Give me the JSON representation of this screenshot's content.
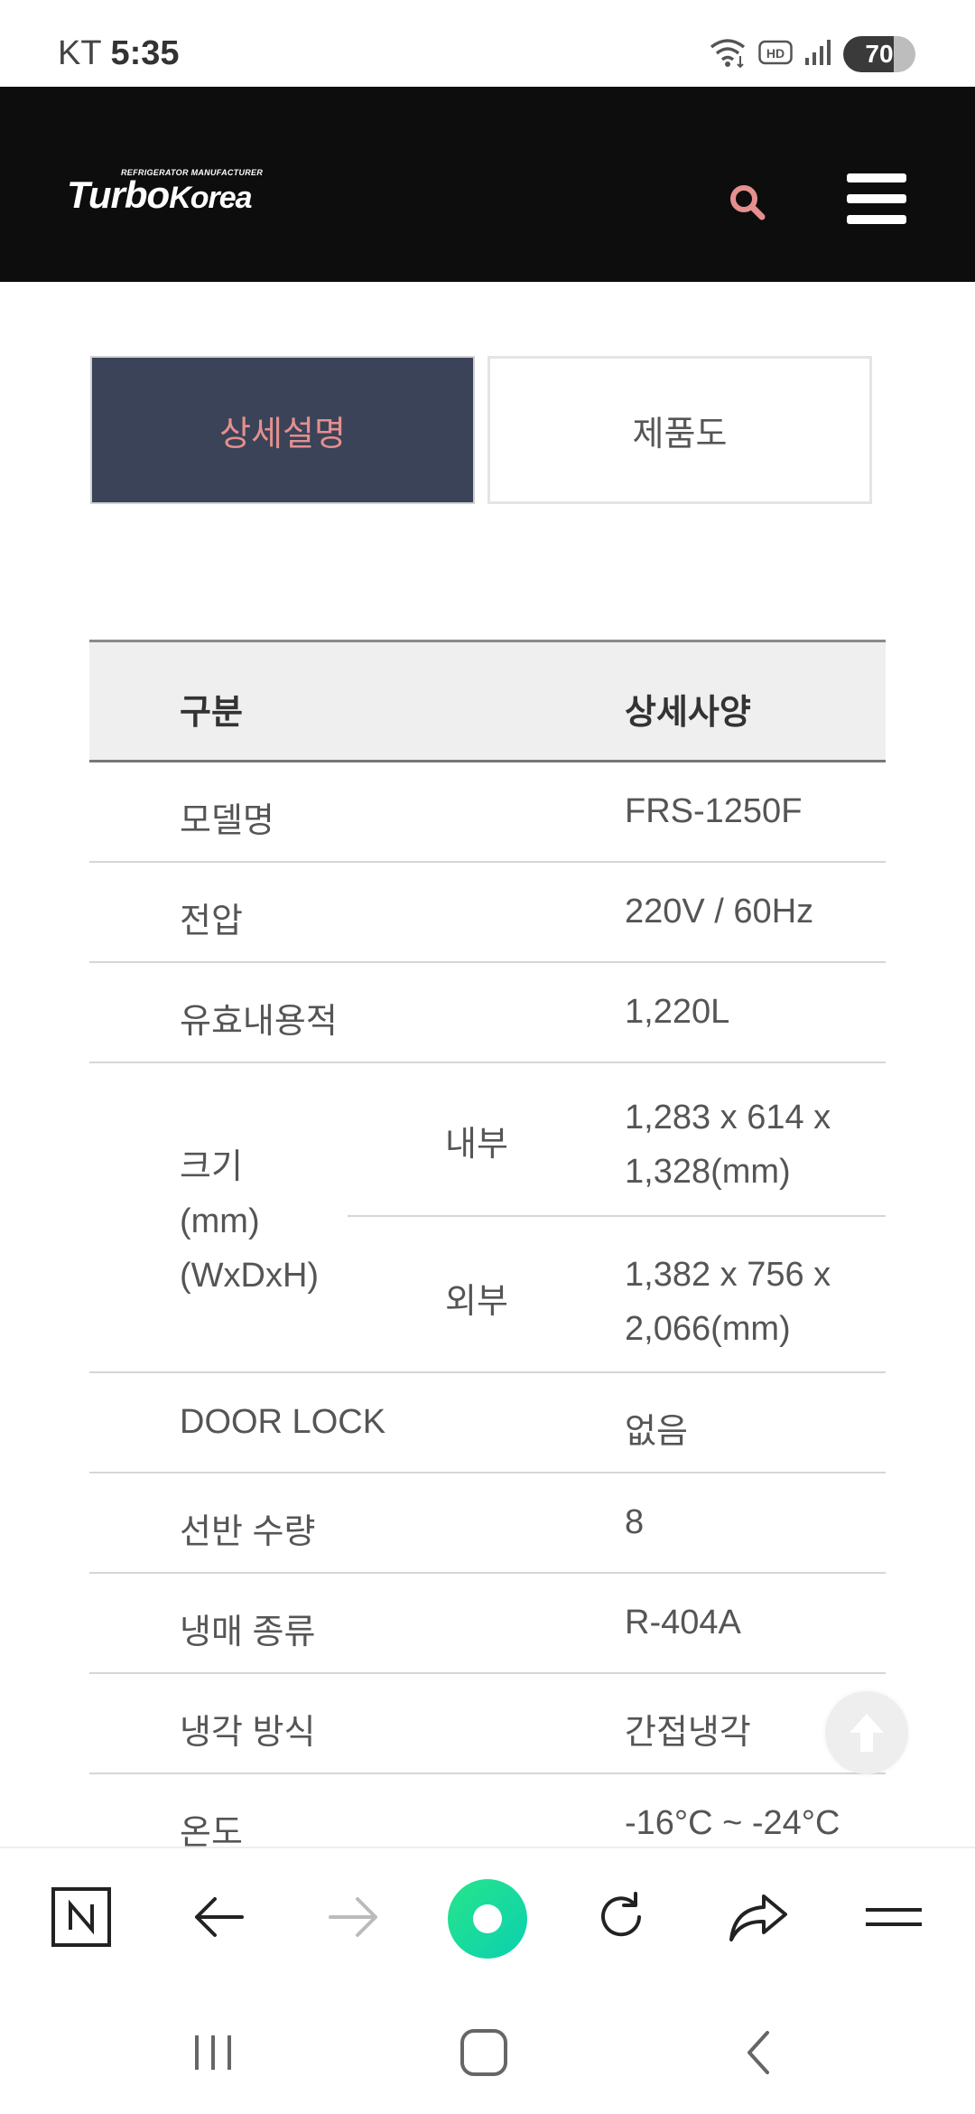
{
  "status_bar": {
    "carrier": "KT",
    "time": "5:35",
    "hd_label": "HD",
    "battery_level": "70",
    "battery_fraction": 0.7
  },
  "header": {
    "logo_main": "Turbo",
    "logo_secondary": "Korea",
    "logo_tagline": "REFRIGERATOR MANUFACTURER",
    "search_icon": "search-icon",
    "menu_icon": "hamburger-menu-icon",
    "accent_color": "#e58f8f"
  },
  "tabs": [
    {
      "label": "상세설명",
      "active": true
    },
    {
      "label": "제품도",
      "active": false
    }
  ],
  "spec_table": {
    "header": {
      "col1": "구분",
      "col2": "상세사양"
    },
    "rows_before": [
      {
        "label": "모델명",
        "value": "FRS-1250F"
      },
      {
        "label": "전압",
        "value": "220V / 60Hz"
      },
      {
        "label": "유효내용적",
        "value": "1,220L"
      }
    ],
    "size": {
      "label_line1": "크기",
      "label_line2": "(mm)",
      "label_line3": "(WxDxH)",
      "inner": {
        "name": "내부",
        "value_line1": "1,283 x 614 x",
        "value_line2": "1,328(mm)"
      },
      "outer": {
        "name": "외부",
        "value_line1": "1,382 x 756 x",
        "value_line2": "2,066(mm)"
      }
    },
    "rows_after": [
      {
        "label": "DOOR LOCK",
        "value": "없음"
      },
      {
        "label": "선반 수량",
        "value": "8"
      },
      {
        "label": "냉매 종류",
        "value": "R-404A"
      },
      {
        "label": "냉각 방식",
        "value": "간접냉각"
      },
      {
        "label": "온도",
        "value": "-16°C ~ -24°C"
      }
    ]
  },
  "scroll_top_icon": "arrow-up-icon",
  "browser_toolbar": {
    "items": [
      "n-logo-icon",
      "back-arrow-icon",
      "forward-arrow-icon",
      "green-dot-icon",
      "refresh-icon",
      "share-icon",
      "menu-lines-icon"
    ]
  },
  "nav_bar": {
    "items": [
      "recents-icon",
      "home-icon",
      "back-icon"
    ]
  }
}
